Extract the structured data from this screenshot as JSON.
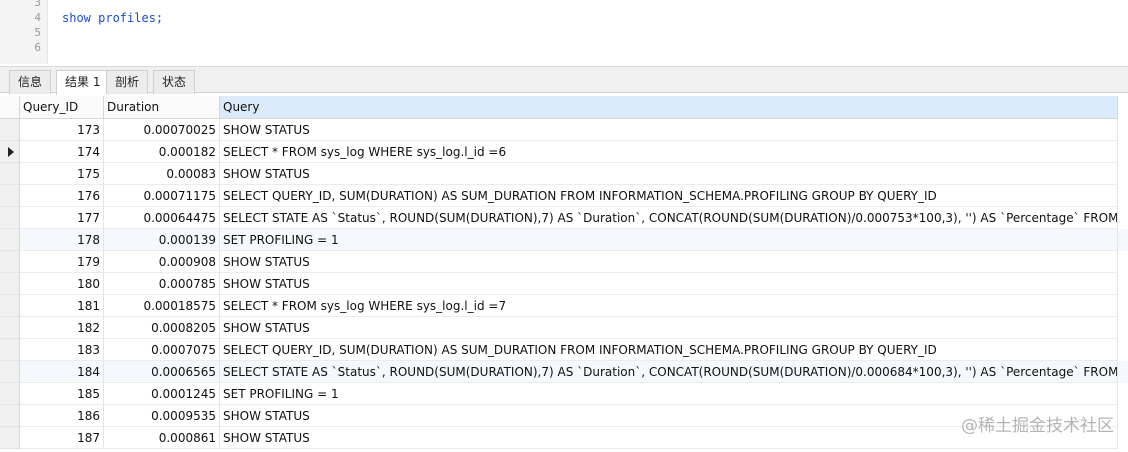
{
  "editor": {
    "line_numbers": [
      "3",
      "4",
      "5",
      "6"
    ],
    "code": "show profiles;"
  },
  "tabs": [
    {
      "label": "信息"
    },
    {
      "label": "结果 1"
    },
    {
      "label": "剖析"
    },
    {
      "label": "状态"
    }
  ],
  "active_tab": "结果 1",
  "table": {
    "columns": [
      "Query_ID",
      "Duration",
      "Query"
    ],
    "rows": [
      {
        "id": "173",
        "duration": "0.00070025",
        "query": "SHOW STATUS"
      },
      {
        "id": "174",
        "duration": "0.000182",
        "query": "SELECT * FROM sys_log WHERE sys_log.l_id =6"
      },
      {
        "id": "175",
        "duration": "0.00083",
        "query": "SHOW STATUS"
      },
      {
        "id": "176",
        "duration": "0.00071175",
        "query": "SELECT QUERY_ID, SUM(DURATION) AS SUM_DURATION FROM INFORMATION_SCHEMA.PROFILING GROUP BY QUERY_ID"
      },
      {
        "id": "177",
        "duration": "0.00064475",
        "query": "SELECT STATE AS `Status`, ROUND(SUM(DURATION),7) AS `Duration`, CONCAT(ROUND(SUM(DURATION)/0.000753*100,3), '') AS `Percentage` FROM INFC"
      },
      {
        "id": "178",
        "duration": "0.000139",
        "query": "SET PROFILING = 1"
      },
      {
        "id": "179",
        "duration": "0.000908",
        "query": "SHOW STATUS"
      },
      {
        "id": "180",
        "duration": "0.000785",
        "query": "SHOW STATUS"
      },
      {
        "id": "181",
        "duration": "0.00018575",
        "query": "SELECT * FROM sys_log WHERE sys_log.l_id =7"
      },
      {
        "id": "182",
        "duration": "0.0008205",
        "query": "SHOW STATUS"
      },
      {
        "id": "183",
        "duration": "0.0007075",
        "query": "SELECT QUERY_ID, SUM(DURATION) AS SUM_DURATION FROM INFORMATION_SCHEMA.PROFILING GROUP BY QUERY_ID"
      },
      {
        "id": "184",
        "duration": "0.0006565",
        "query": "SELECT STATE AS `Status`, ROUND(SUM(DURATION),7) AS `Duration`, CONCAT(ROUND(SUM(DURATION)/0.000684*100,3), '') AS `Percentage` FROM INFC"
      },
      {
        "id": "185",
        "duration": "0.0001245",
        "query": "SET PROFILING = 1"
      },
      {
        "id": "186",
        "duration": "0.0009535",
        "query": "SHOW STATUS"
      },
      {
        "id": "187",
        "duration": "0.000861",
        "query": "SHOW STATUS"
      }
    ],
    "current_row_id": "174"
  },
  "watermark": "@稀土掘金技术社区",
  "colors": {
    "code_keyword": "#1a4ec9",
    "selected_column_header": "#dcebfb",
    "alt_row": "#f5f9fd"
  }
}
